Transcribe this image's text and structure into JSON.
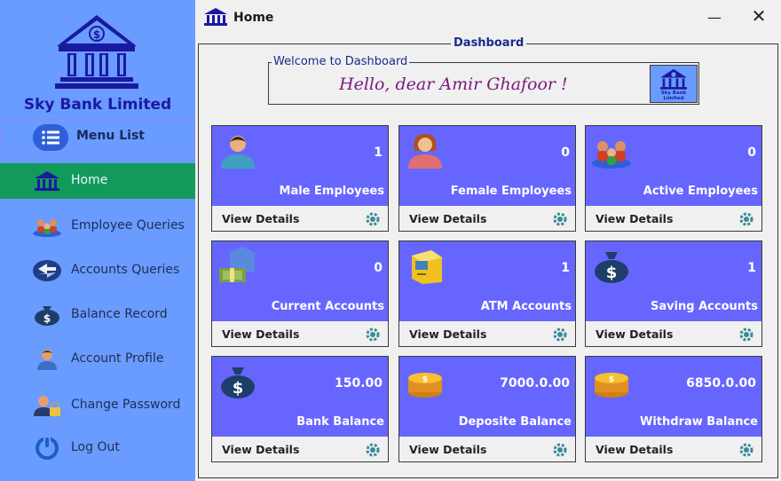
{
  "sidebar": {
    "bank_name": "Sky Bank Limited",
    "menu_label": "Menu List",
    "items": [
      {
        "label": "Home",
        "icon": "bank-icon"
      },
      {
        "label": "Employee Queries",
        "icon": "employees-icon"
      },
      {
        "label": "Accounts Queries",
        "icon": "exchange-icon"
      },
      {
        "label": "Balance Record",
        "icon": "money-bag-icon"
      },
      {
        "label": "Account Profile",
        "icon": "user-icon"
      },
      {
        "label": "Change Password",
        "icon": "user-lock-icon"
      },
      {
        "label": "Log Out",
        "icon": "power-icon"
      }
    ]
  },
  "window": {
    "title": "Home",
    "minimize": "—",
    "close": "✕"
  },
  "dashboard": {
    "legend": "Dashboard",
    "welcome_legend": "Welcome to Dashboard",
    "greeting": "Hello, dear Amir Ghafoor !",
    "mini_logo_text": "Sky Bank Limited",
    "view_details": "View Details",
    "cards": [
      {
        "value": "1",
        "label": "Male Employees"
      },
      {
        "value": "0",
        "label": "Female Employees"
      },
      {
        "value": "0",
        "label": "Active Employees"
      },
      {
        "value": "0",
        "label": "Current Accounts"
      },
      {
        "value": "1",
        "label": "ATM Accounts"
      },
      {
        "value": "1",
        "label": "Saving Accounts"
      },
      {
        "value": "150.00",
        "label": "Bank Balance"
      },
      {
        "value": "7000.0.00",
        "label": "Deposite Balance"
      },
      {
        "value": "6850.0.00",
        "label": "Withdraw Balance"
      }
    ]
  },
  "colors": {
    "sidebar_bg": "#6a9bff",
    "active_item": "#129a5a",
    "card_bg": "#6666ff",
    "brand_text": "#1a1aa0",
    "greeting_text": "#7a1a7a"
  }
}
